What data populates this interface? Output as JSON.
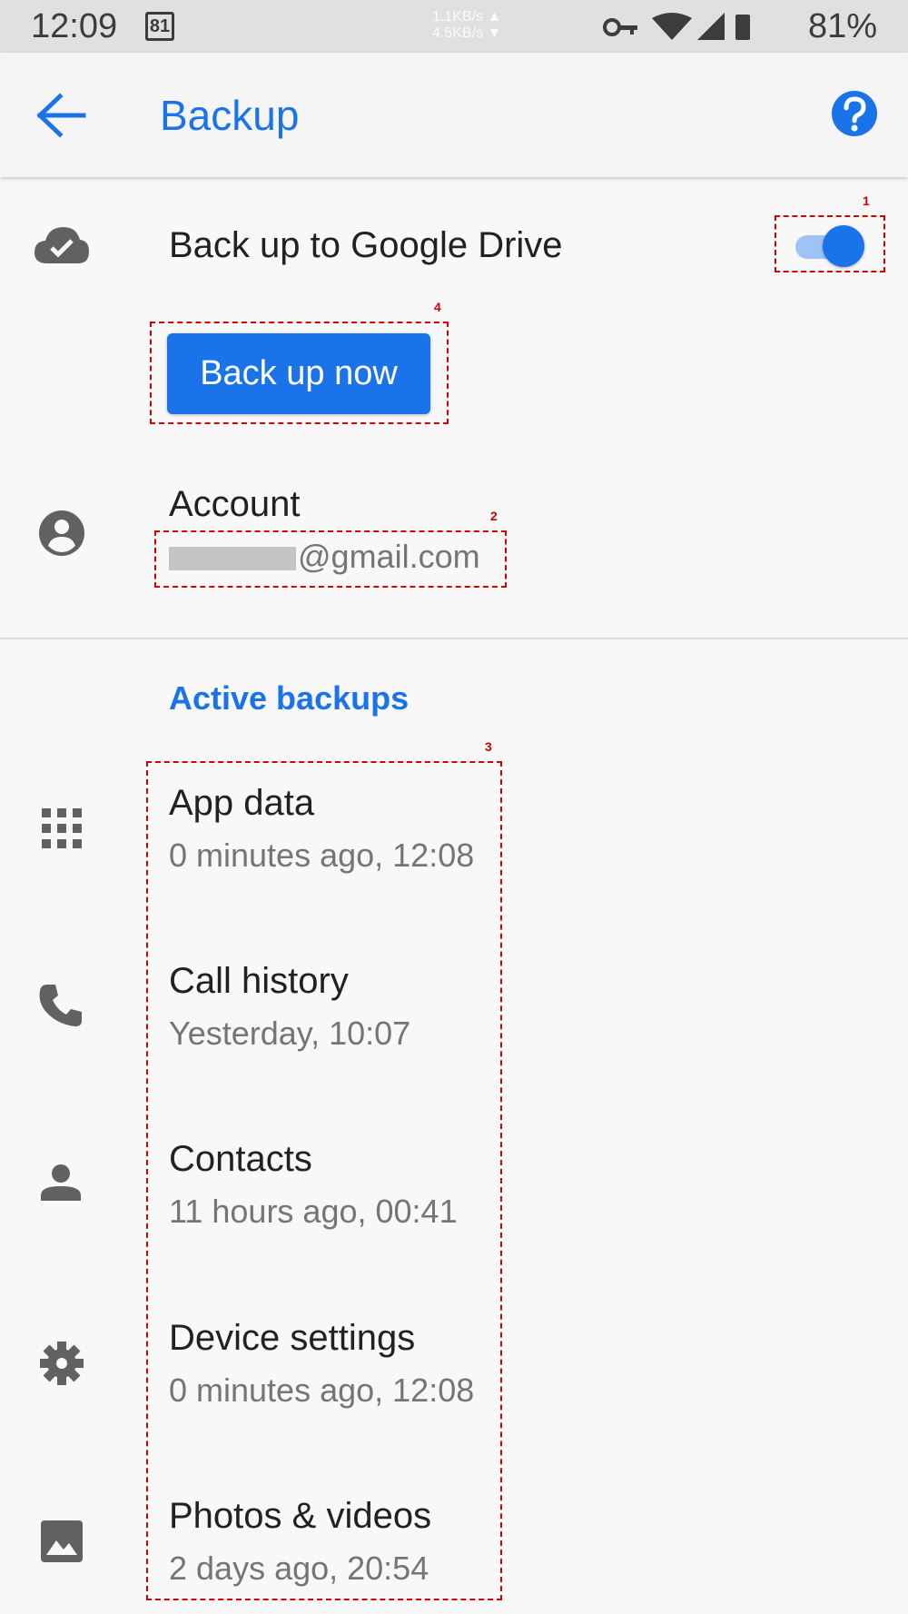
{
  "status_bar": {
    "time": "12:09",
    "calendar_day": "81",
    "upload_speed": "1.1KB/s ▲",
    "download_speed": "4.5KB/s ▼",
    "battery": "81%"
  },
  "app_bar": {
    "title": "Backup"
  },
  "backup_toggle": {
    "label": "Back up to Google Drive",
    "enabled": true
  },
  "backup_now_button": {
    "label": "Back up now"
  },
  "account": {
    "label": "Account",
    "email_suffix": "@gmail.com"
  },
  "active_backups": {
    "header": "Active backups",
    "items": [
      {
        "label": "App data",
        "status": "0 minutes ago, 12:08",
        "icon": "apps-grid-icon"
      },
      {
        "label": "Call history",
        "status": "Yesterday, 10:07",
        "icon": "phone-icon"
      },
      {
        "label": "Contacts",
        "status": "11 hours ago, 00:41",
        "icon": "person-icon"
      },
      {
        "label": "Device settings",
        "status": "0 minutes ago, 12:08",
        "icon": "gear-icon"
      },
      {
        "label": "Photos & videos",
        "status": "2 days ago, 20:54",
        "icon": "image-icon"
      }
    ]
  },
  "annotations": [
    "1",
    "2",
    "3",
    "4"
  ],
  "colors": {
    "accent": "#1a73e8",
    "annotation": "#d50000"
  }
}
